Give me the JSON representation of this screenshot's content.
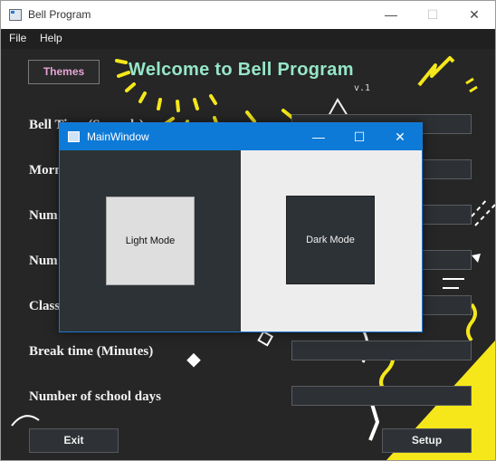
{
  "window": {
    "title": "Bell Program",
    "minimize_glyph": "—",
    "maximize_glyph": "☐",
    "close_glyph": "✕"
  },
  "menu": [
    "File",
    "Help"
  ],
  "main": {
    "themes_label": "Themes",
    "welcome": "Welcome to Bell Program",
    "version": "v.1",
    "rows": [
      "Bell Time (Seconds)",
      "Morn",
      "Num",
      "Num",
      "Class",
      "Break time (Minutes)",
      "Number of school days"
    ],
    "exit_label": "Exit",
    "setup_label": "Setup"
  },
  "dialog": {
    "title": "MainWindow",
    "minimize_glyph": "—",
    "maximize_glyph": "☐",
    "close_glyph": "✕",
    "light_label": "Light Mode",
    "dark_label": "Dark Mode"
  },
  "colors": {
    "accent": "#0e7ad7",
    "background": "#262626",
    "decor_yellow": "#f5e71a",
    "welcome_text": "#96e6c8"
  }
}
